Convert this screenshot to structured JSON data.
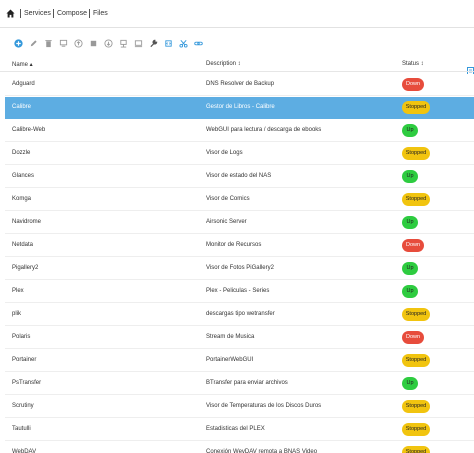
{
  "breadcrumb": {
    "items": [
      {
        "label": "Services"
      },
      {
        "label": "Compose"
      },
      {
        "label": "Files"
      }
    ]
  },
  "toolbar": {
    "icons": [
      "add-icon",
      "edit-icon",
      "delete-icon",
      "deploy-icon",
      "upload-icon",
      "stop-icon",
      "download-icon",
      "pull-icon",
      "wrench-icon",
      "cut-icon",
      "scissors-icon",
      "link-icon"
    ],
    "accent": "#3498db"
  },
  "table": {
    "columns": {
      "name": "Name ▴",
      "description": "Description ↕",
      "status": "Status ↕"
    },
    "rows": [
      {
        "name": "Adguard",
        "description": "DNS Resolver de Backup",
        "status": "Down",
        "state": "down",
        "selected": false
      },
      {
        "name": "Calibre",
        "description": "Gestor de Libros - Calibre",
        "status": "Stopped",
        "state": "stopped",
        "selected": true
      },
      {
        "name": "Calibre-Web",
        "description": "WebGUI para lectura / descarga de ebooks",
        "status": "Up",
        "state": "up",
        "selected": false
      },
      {
        "name": "Dozzle",
        "description": "Visor de Logs",
        "status": "Stopped",
        "state": "stopped",
        "selected": false
      },
      {
        "name": "Glances",
        "description": "Visor de estado del NAS",
        "status": "Up",
        "state": "up",
        "selected": false
      },
      {
        "name": "Komga",
        "description": "Visor de Comics",
        "status": "Stopped",
        "state": "stopped",
        "selected": false
      },
      {
        "name": "Navidrome",
        "description": "Airsonic Server",
        "status": "Up",
        "state": "up",
        "selected": false
      },
      {
        "name": "Netdata",
        "description": "Monitor de Recursos",
        "status": "Down",
        "state": "down",
        "selected": false
      },
      {
        "name": "Pigallery2",
        "description": "Visor de Fotos PiGallery2",
        "status": "Up",
        "state": "up",
        "selected": false
      },
      {
        "name": "Plex",
        "description": "Plex - Peliculas - Series",
        "status": "Up",
        "state": "up",
        "selected": false
      },
      {
        "name": "plik",
        "description": "descargas tipo wetransfer",
        "status": "Stopped",
        "state": "stopped",
        "selected": false
      },
      {
        "name": "Polaris",
        "description": "Stream de Musica",
        "status": "Down",
        "state": "down",
        "selected": false
      },
      {
        "name": "Portainer",
        "description": "PortainerWebGUI",
        "status": "Stopped",
        "state": "stopped",
        "selected": false
      },
      {
        "name": "PsTransfer",
        "description": "BTransfer para enviar archivos",
        "status": "Up",
        "state": "up",
        "selected": false
      },
      {
        "name": "Scrutiny",
        "description": "Visor de Temperaturas de los Discos Duros",
        "status": "Stopped",
        "state": "stopped",
        "selected": false
      },
      {
        "name": "Tautulli",
        "description": "Estadisticas del PLEX",
        "status": "Stopped",
        "state": "stopped",
        "selected": false
      },
      {
        "name": "WebDAV",
        "description": "Conexión WevDAV remota a BNAS Video",
        "status": "Stopped",
        "state": "stopped",
        "selected": false
      }
    ]
  },
  "colors": {
    "selected_row": "#5dade2",
    "status_up": "#2ecc40",
    "status_down": "#e74c3c",
    "status_stopped": "#f1c40f"
  }
}
